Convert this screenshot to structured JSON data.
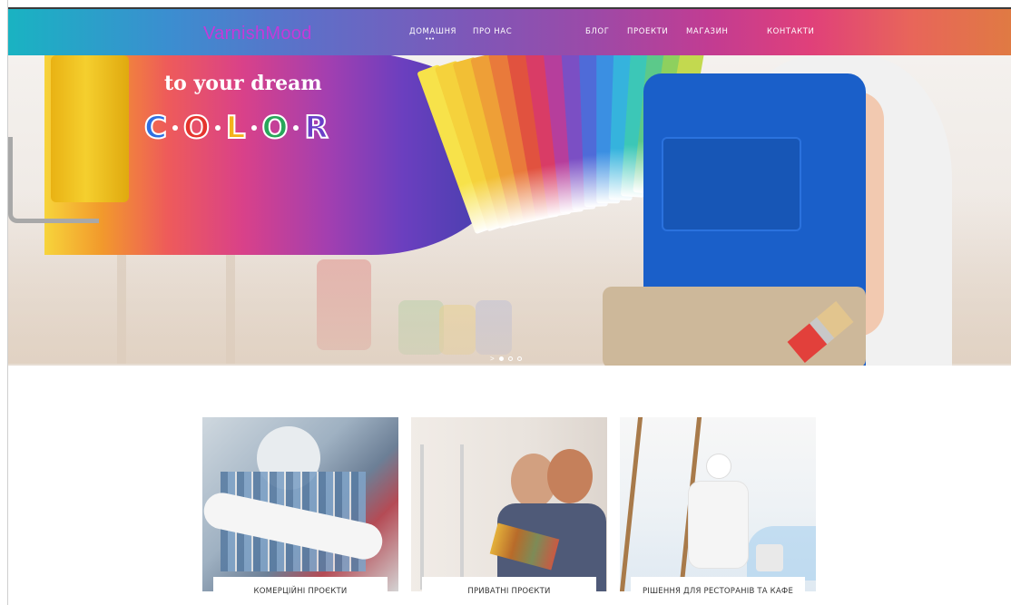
{
  "header": {
    "logo": "VarnishMood",
    "nav": [
      {
        "label": "ДОМАШНЯ"
      },
      {
        "label": "ПРО НАС"
      },
      {
        "label": "БЛОГ"
      },
      {
        "label": "ПРОЕКТИ"
      },
      {
        "label": "МАГАЗИН"
      },
      {
        "label": "КОНТАКТИ"
      }
    ],
    "active_indicator": "•••"
  },
  "hero": {
    "tagline": "to your dream",
    "color_letters": [
      {
        "char": "C",
        "color": "#2f6fe0"
      },
      {
        "char": "O",
        "color": "#e5352e"
      },
      {
        "char": "L",
        "color": "#f4b21b"
      },
      {
        "char": "O",
        "color": "#28a65a"
      },
      {
        "char": "R",
        "color": "#6a3fc8"
      }
    ],
    "slider": {
      "arrow": ">",
      "count": 3,
      "active": 0
    }
  },
  "cards": [
    {
      "label": "КОМЕРЦІЙНІ ПРОЄКТИ"
    },
    {
      "label": "ПРИВАТНІ ПРОЄКТИ"
    },
    {
      "label": "РІШЕННЯ ДЛЯ РЕСТОРАНІВ ТА КАФЕ"
    }
  ],
  "colors": {
    "logo": "#c43ad9",
    "nav_gradient_start": "#19b3c2",
    "nav_gradient_end": "#e07a43"
  }
}
